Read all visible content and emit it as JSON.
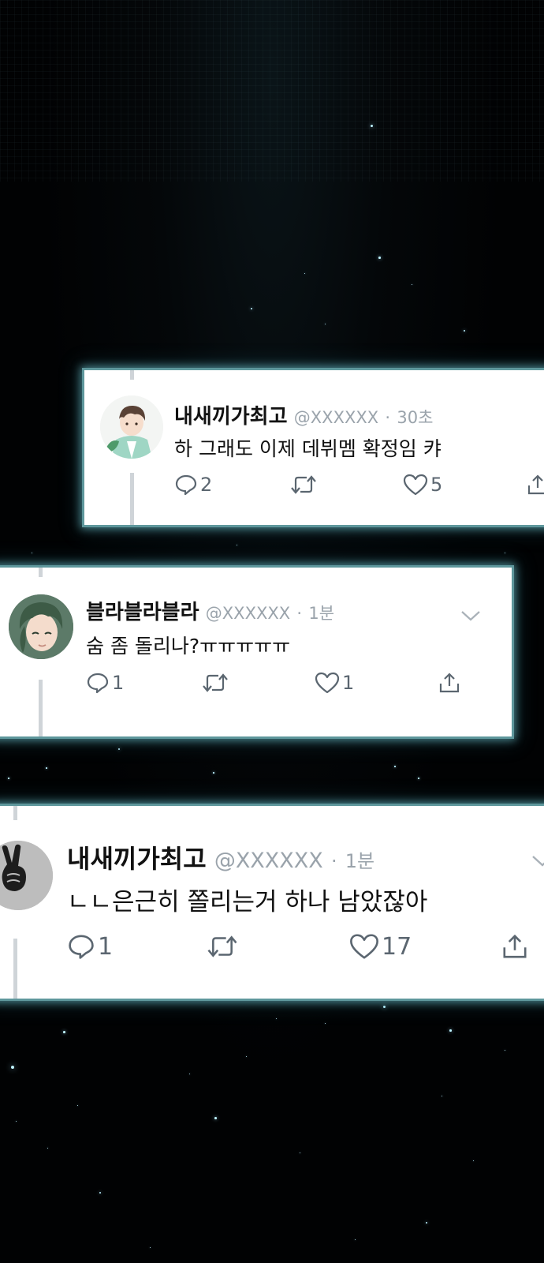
{
  "tweets": [
    {
      "name": "내새끼가최고",
      "handle": "@XXXXXX",
      "separator": "·",
      "time": "30초",
      "text": "하 그래도 이제 데뷔멤 확정임 캬",
      "replies": "2",
      "likes": "5"
    },
    {
      "name": "블라블라블라",
      "handle": "@XXXXXX",
      "separator": "·",
      "time": "1분",
      "text": "숨 좀 돌리나?ㅠㅠㅠㅠㅠ",
      "replies": "1",
      "likes": "1"
    },
    {
      "name": "내새끼가최고",
      "handle": "@XXXXXX",
      "separator": "·",
      "time": "1분",
      "text": "ㄴㄴ은근히 쫄리는거 하나 남았잖아",
      "replies": "1",
      "likes": "17"
    }
  ],
  "icons": {
    "reply": "speech-bubble-icon",
    "retweet": "retweet-arrows-icon",
    "like": "heart-icon",
    "share": "share-upload-icon",
    "more": "chevron-down-icon"
  },
  "colors": {
    "card_border": "#5e979c",
    "glow": "#78d2dc",
    "icon": "#5b6670",
    "handle": "#9aa3ab",
    "background": "#010203"
  }
}
